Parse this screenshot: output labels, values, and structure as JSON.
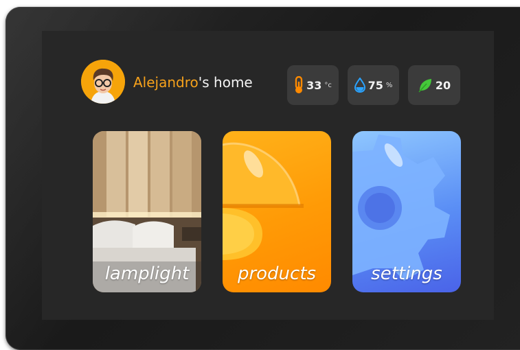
{
  "header": {
    "owner_name": "Alejandro",
    "title_suffix": "'s home",
    "avatar": "user-avatar"
  },
  "stats": [
    {
      "icon": "thermometer-icon",
      "value": "33",
      "unit": "°c",
      "color": "#ff8a00"
    },
    {
      "icon": "water-drop-icon",
      "value": "75",
      "unit": "%",
      "color": "#2aa3ff"
    },
    {
      "icon": "leaf-icon",
      "value": "20",
      "unit": "",
      "color": "#45c93a"
    }
  ],
  "cards": [
    {
      "label": "lamplight",
      "icon": "bedroom-photo"
    },
    {
      "label": "products",
      "icon": "lamp-icon"
    },
    {
      "label": "settings",
      "icon": "gear-icon"
    }
  ],
  "colors": {
    "accent": "#f7a21b",
    "background": "#272727",
    "tile": "#3b3b3b"
  }
}
